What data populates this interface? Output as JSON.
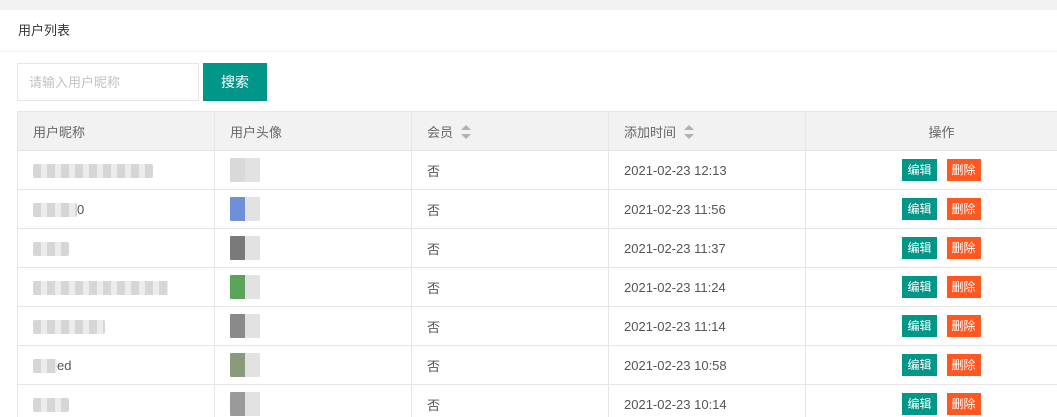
{
  "panel": {
    "title": "用户列表"
  },
  "search": {
    "placeholder": "请输入用户昵称",
    "value": "",
    "button_label": "搜索"
  },
  "table": {
    "columns": [
      {
        "label": "用户昵称",
        "sortable": false
      },
      {
        "label": "用户头像",
        "sortable": false
      },
      {
        "label": "会员",
        "sortable": true
      },
      {
        "label": "添加时间",
        "sortable": true
      },
      {
        "label": "操作",
        "sortable": false
      }
    ],
    "rows": [
      {
        "nickname_visible": "",
        "avatar_color": "#d9d9d9",
        "member": "否",
        "added_at": "2021-02-23 12:13"
      },
      {
        "nickname_visible": "0",
        "avatar_color": "#6f8fd8",
        "member": "否",
        "added_at": "2021-02-23 11:56"
      },
      {
        "nickname_visible": "",
        "avatar_color": "#7a7a7a",
        "member": "否",
        "added_at": "2021-02-23 11:37"
      },
      {
        "nickname_visible": "",
        "avatar_color": "#5aa55a",
        "member": "否",
        "added_at": "2021-02-23 11:24"
      },
      {
        "nickname_visible": "",
        "avatar_color": "#8a8a8a",
        "member": "否",
        "added_at": "2021-02-23 11:14"
      },
      {
        "nickname_visible": "ed",
        "avatar_color": "#8a9a7a",
        "member": "否",
        "added_at": "2021-02-23 10:58"
      },
      {
        "nickname_visible": "",
        "avatar_color": "#9a9a9a",
        "member": "否",
        "added_at": "2021-02-23 10:14"
      }
    ],
    "edit_label": "编辑",
    "delete_label": "删除"
  },
  "colors": {
    "primary": "#009688",
    "danger": "#FF5722",
    "header_bg": "#f2f2f2",
    "border": "#e6e6e6"
  }
}
